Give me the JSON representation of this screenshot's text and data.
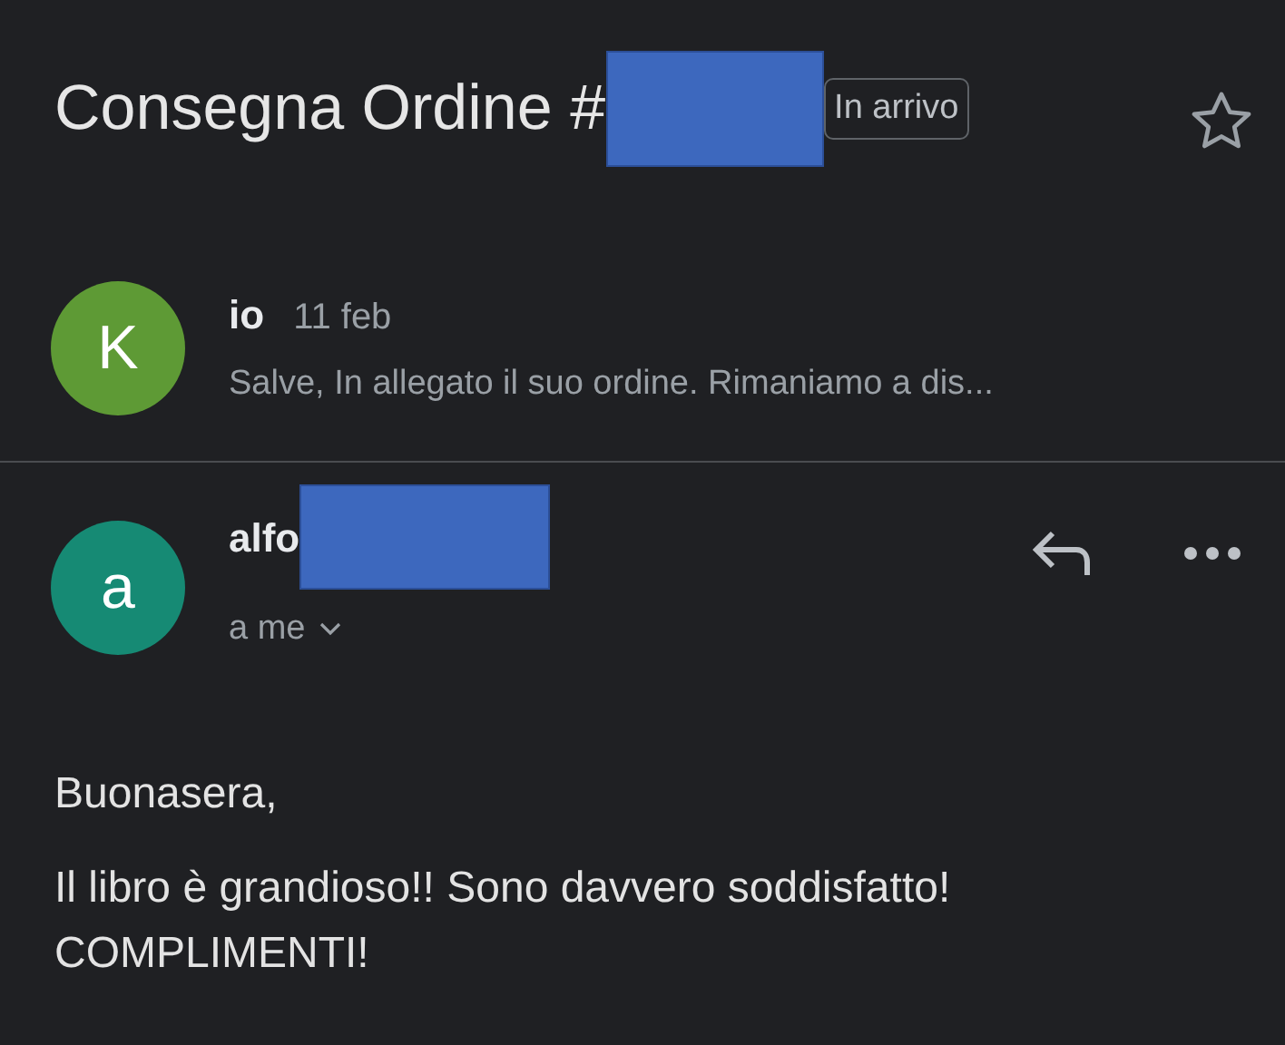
{
  "subject": {
    "title": "Consegna Ordine #",
    "label": "In arrivo",
    "starred": false
  },
  "messages": [
    {
      "kind": "collapsed",
      "avatar": "K",
      "color": "#5e9a35",
      "sender": "io",
      "date": "11 feb",
      "snippet": "Salve, In allegato il suo ordine. Rimaniamo a dis..."
    },
    {
      "kind": "expanded",
      "avatar": "a",
      "color": "#168a74",
      "sender": "alfo",
      "recipient": "a me",
      "body": [
        "Buonasera,",
        "Il libro è grandioso!! Sono davvero soddisfatto! COMPLIMENTI!"
      ]
    }
  ]
}
